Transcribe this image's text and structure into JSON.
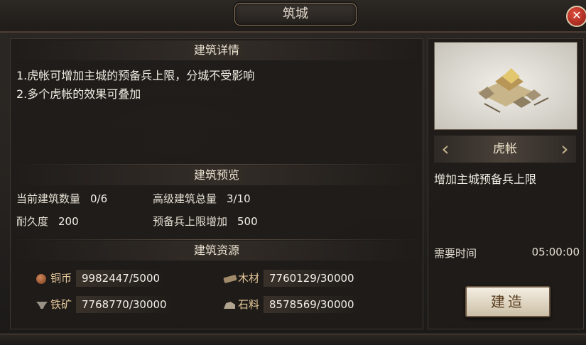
{
  "window": {
    "title": "筑城",
    "close_icon": "close-icon",
    "accent_color": "#8a7358",
    "close_color": "#c0392b"
  },
  "details": {
    "heading": "建筑详情",
    "lines": [
      "1.虎帐可增加主城的预备兵上限，分城不受影响",
      "2.多个虎帐的效果可叠加"
    ]
  },
  "preview": {
    "heading": "建筑预览",
    "stats": [
      {
        "label": "当前建筑数量",
        "value": "0/6"
      },
      {
        "label": "高级建筑总量",
        "value": "3/10"
      },
      {
        "label": "耐久度",
        "value": "200"
      },
      {
        "label": "预备兵上限增加",
        "value": "500"
      }
    ]
  },
  "resources": {
    "heading": "建筑资源",
    "items": [
      {
        "name": "铜币",
        "amount": "9982447/5000",
        "icon": "copper-coin-icon"
      },
      {
        "name": "木材",
        "amount": "7760129/30000",
        "icon": "wood-icon"
      },
      {
        "name": "铁矿",
        "amount": "7768770/30000",
        "icon": "iron-ore-icon"
      },
      {
        "name": "石料",
        "amount": "8578569/30000",
        "icon": "stone-icon"
      }
    ]
  },
  "building": {
    "name": "虎帐",
    "description": "增加主城预备兵上限",
    "time_label": "需要时间",
    "time_value": "05:00:00",
    "build_label": "建造"
  }
}
